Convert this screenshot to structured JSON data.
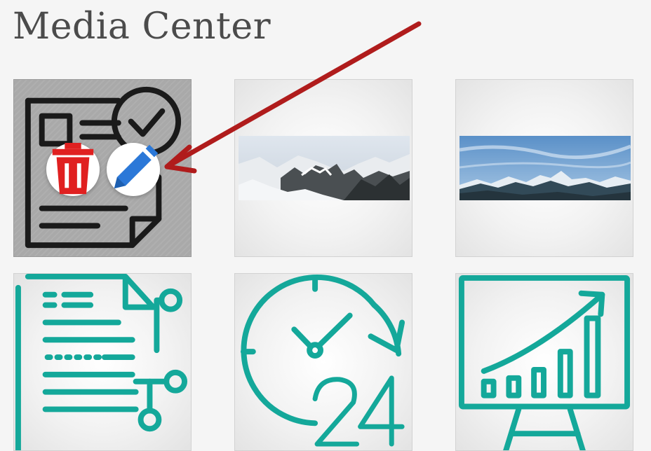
{
  "page": {
    "title": "Media Center"
  },
  "colors": {
    "accent_teal": "#14a89a",
    "delete_red": "#e02020",
    "edit_blue": "#2b78d8",
    "annotation_arrow": "#b01c1c",
    "document_icon_stroke": "#1a1a1a"
  },
  "media_items": [
    {
      "icon": "document-check-icon",
      "selected": true
    },
    {
      "icon": "snowy-mountain-photo"
    },
    {
      "icon": "blue-sky-mountain-photo"
    },
    {
      "icon": "document-network-icon"
    },
    {
      "icon": "clock-24-hours-icon"
    },
    {
      "icon": "presentation-chart-icon"
    }
  ],
  "actions": {
    "delete_icon": "trash-icon",
    "edit_icon": "pencil-icon"
  }
}
